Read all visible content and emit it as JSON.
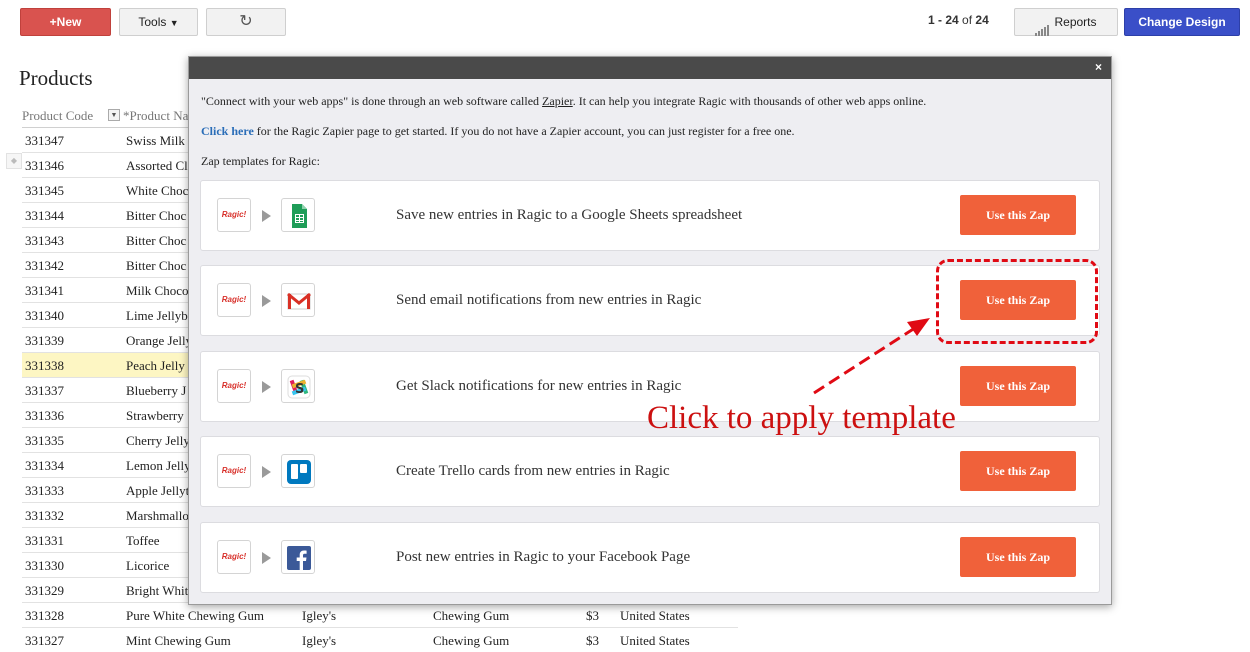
{
  "toolbar": {
    "new_label": "+New",
    "tools_label": "Tools",
    "refresh_glyph": "↻",
    "pager_range": "1 - 24",
    "pager_of": "of",
    "pager_total": "24",
    "reports_label": "Reports",
    "design_label": "Change Design",
    "accent_new": "#d9534f",
    "accent_design": "#3a4fc8"
  },
  "page": {
    "title": "Products"
  },
  "table": {
    "headers": [
      "Product Code",
      "*Product Na"
    ],
    "rows": [
      {
        "code": "331347",
        "name": "Swiss Milk",
        "brand": "",
        "cat": "",
        "price": "",
        "country": ""
      },
      {
        "code": "331346",
        "name": "Assorted Cl",
        "brand": "",
        "cat": "",
        "price": "",
        "country": ""
      },
      {
        "code": "331345",
        "name": "White Choc",
        "brand": "",
        "cat": "",
        "price": "",
        "country": ""
      },
      {
        "code": "331344",
        "name": "Bitter Choc",
        "brand": "",
        "cat": "",
        "price": "",
        "country": ""
      },
      {
        "code": "331343",
        "name": "Bitter Choc",
        "brand": "",
        "cat": "",
        "price": "",
        "country": ""
      },
      {
        "code": "331342",
        "name": "Bitter Choc",
        "brand": "",
        "cat": "",
        "price": "",
        "country": ""
      },
      {
        "code": "331341",
        "name": "Milk Choco",
        "brand": "",
        "cat": "",
        "price": "",
        "country": ""
      },
      {
        "code": "331340",
        "name": "Lime Jellyb",
        "brand": "",
        "cat": "",
        "price": "",
        "country": ""
      },
      {
        "code": "331339",
        "name": "Orange Jelly",
        "brand": "",
        "cat": "",
        "price": "",
        "country": ""
      },
      {
        "code": "331338",
        "name": "Peach Jelly",
        "brand": "",
        "cat": "",
        "price": "",
        "country": "",
        "highlight": true
      },
      {
        "code": "331337",
        "name": "Blueberry J",
        "brand": "",
        "cat": "",
        "price": "",
        "country": ""
      },
      {
        "code": "331336",
        "name": "Strawberry",
        "brand": "",
        "cat": "",
        "price": "",
        "country": ""
      },
      {
        "code": "331335",
        "name": "Cherry Jelly",
        "brand": "",
        "cat": "",
        "price": "",
        "country": ""
      },
      {
        "code": "331334",
        "name": "Lemon Jelly",
        "brand": "",
        "cat": "",
        "price": "",
        "country": ""
      },
      {
        "code": "331333",
        "name": "Apple Jellyt",
        "brand": "",
        "cat": "",
        "price": "",
        "country": ""
      },
      {
        "code": "331332",
        "name": "Marshmallo",
        "brand": "",
        "cat": "",
        "price": "",
        "country": ""
      },
      {
        "code": "331331",
        "name": "Toffee",
        "brand": "",
        "cat": "",
        "price": "",
        "country": ""
      },
      {
        "code": "331330",
        "name": "Licorice",
        "brand": "",
        "cat": "",
        "price": "",
        "country": ""
      },
      {
        "code": "331329",
        "name": "Bright Whit",
        "brand": "",
        "cat": "",
        "price": "",
        "country": ""
      },
      {
        "code": "331328",
        "name": "Pure White Chewing Gum",
        "brand": "Igley's",
        "cat": "Chewing Gum",
        "price": "$3",
        "country": "United States"
      },
      {
        "code": "331327",
        "name": "Mint Chewing Gum",
        "brand": "Igley's",
        "cat": "Chewing Gum",
        "price": "$3",
        "country": "United States"
      }
    ]
  },
  "dialog": {
    "close_glyph": "×",
    "intro_before_link": "\"Connect with your web apps\" is done through an web software called ",
    "intro_link": "Zapier",
    "intro_after_link": ". It can help you integrate Ragic with thousands of other web apps online.",
    "click_here": "Click here",
    "click_here_rest": " for the Ragic Zapier page to get started. If you do not have a Zapier account, you can just register for a free one.",
    "templates_heading": "Zap templates for Ragic:",
    "ragic_logo_text": "Ragic!",
    "zaps": [
      {
        "icon": "google-sheets-icon",
        "description": "Save new entries in Ragic to a Google Sheets spreadsheet",
        "button": "Use this Zap"
      },
      {
        "icon": "gmail-icon",
        "description": "Send email notifications from new entries in Ragic",
        "button": "Use this Zap"
      },
      {
        "icon": "slack-icon",
        "description": "Get Slack notifications for new entries in Ragic",
        "button": "Use this Zap"
      },
      {
        "icon": "trello-icon",
        "description": "Create Trello cards from new entries in Ragic",
        "button": "Use this Zap"
      },
      {
        "icon": "facebook-icon",
        "description": "Post new entries in Ragic to your Facebook Page",
        "button": "Use this Zap"
      }
    ],
    "button_color": "#f0613a"
  },
  "annotation": {
    "text": "Click to apply template",
    "color": "#cc1010"
  }
}
